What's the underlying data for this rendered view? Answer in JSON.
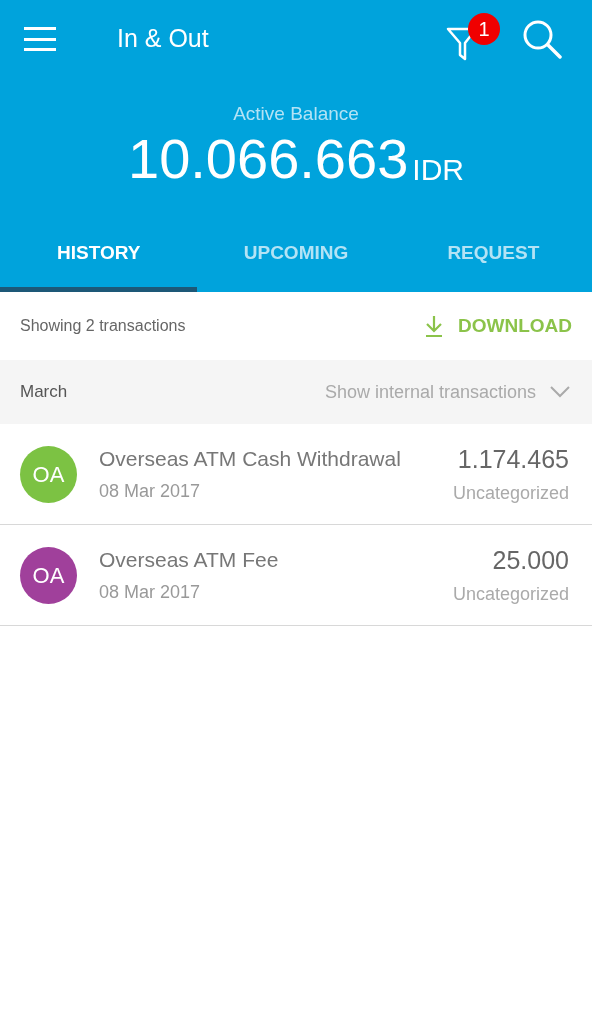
{
  "app_bar": {
    "title": "In & Out",
    "filter_badge": "1"
  },
  "balance": {
    "label": "Active Balance",
    "amount": "10.066.663",
    "currency": "IDR"
  },
  "tabs": [
    {
      "label": "HISTORY",
      "selected": true
    },
    {
      "label": "UPCOMING",
      "selected": false
    },
    {
      "label": "REQUEST",
      "selected": false
    }
  ],
  "summary": {
    "text": "Showing 2 transactions",
    "download": "DOWNLOAD"
  },
  "section": {
    "month": "March",
    "toggle": "Show internal transactions"
  },
  "transactions": [
    {
      "initials": "OA",
      "color": "#7cc243",
      "title": "Overseas ATM Cash Withdrawal",
      "date": "08 Mar 2017",
      "amount": "1.174.465",
      "category": "Uncategorized"
    },
    {
      "initials": "OA",
      "color": "#a0409b",
      "title": "Overseas ATM Fee",
      "date": "08 Mar 2017",
      "amount": "25.000",
      "category": "Uncategorized"
    }
  ]
}
